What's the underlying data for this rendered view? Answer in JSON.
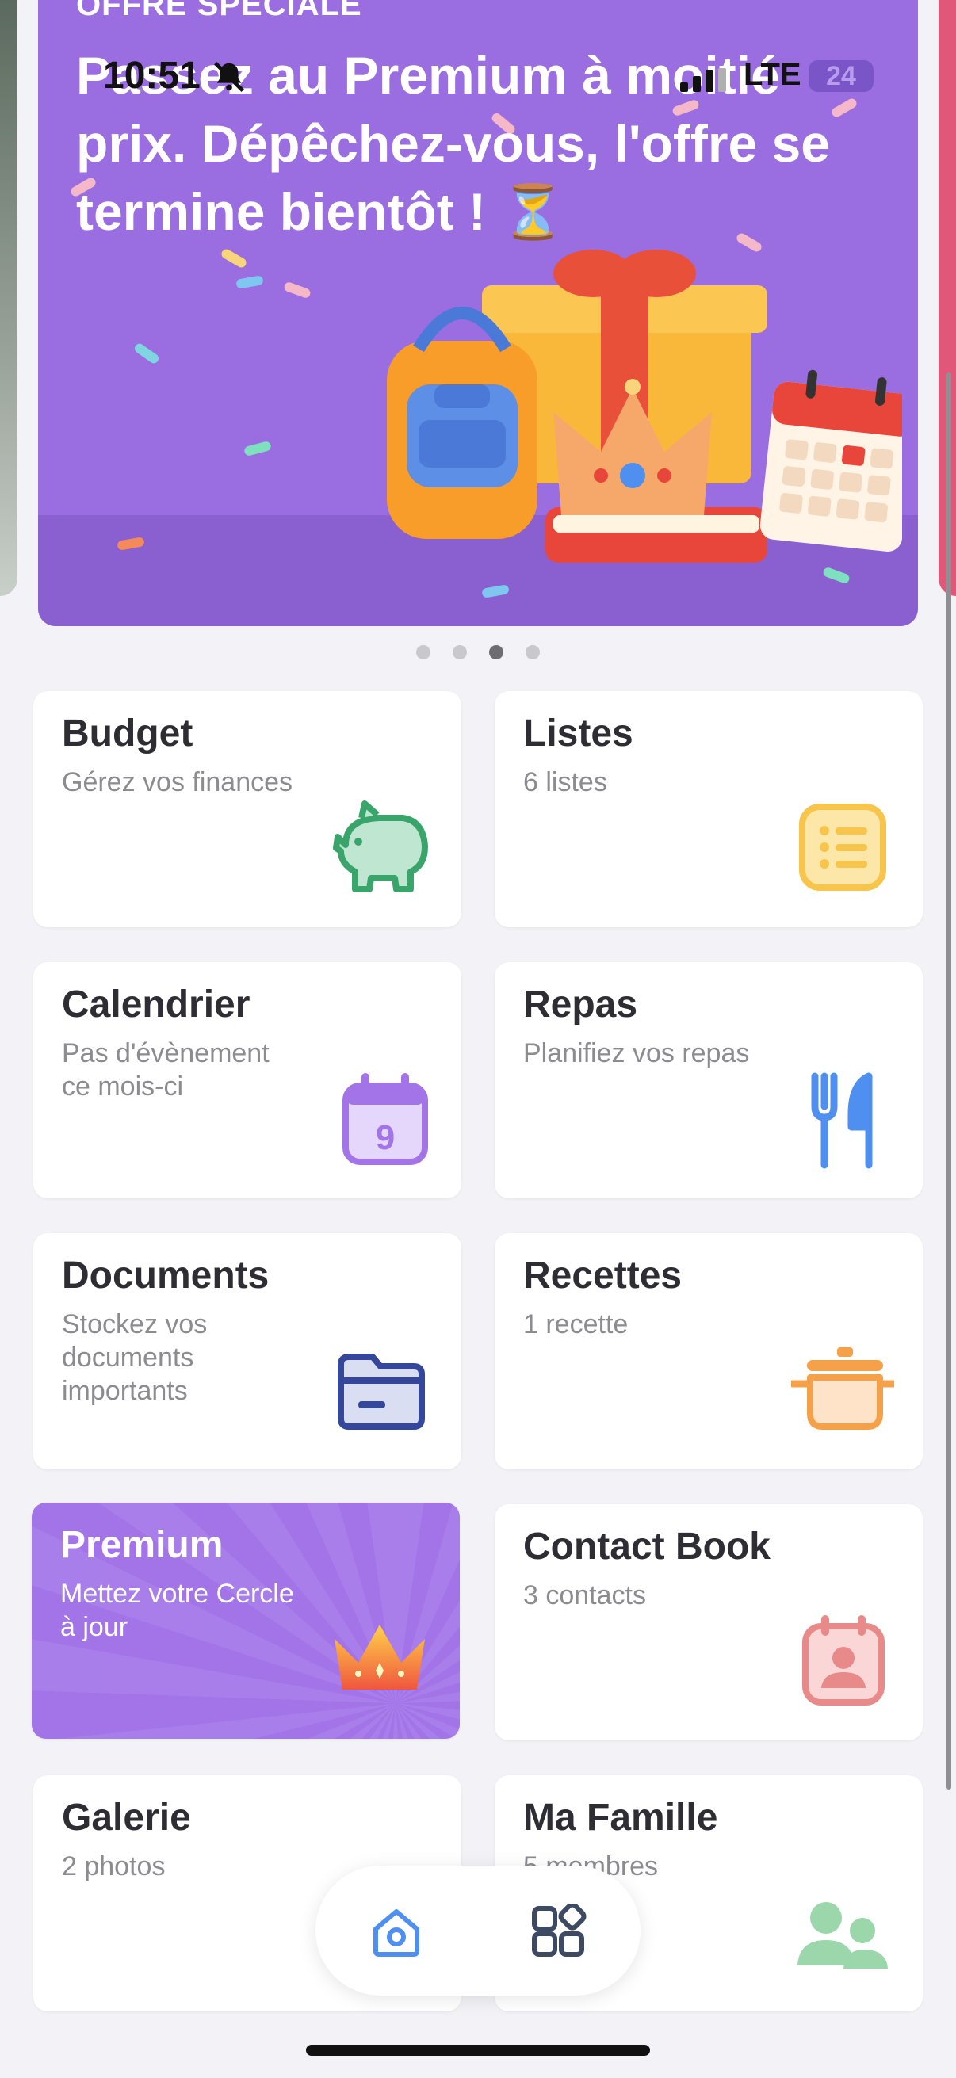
{
  "status_bar": {
    "time": "10:51",
    "network": "LTE",
    "battery": "24"
  },
  "banner": {
    "eyebrow": "OFFRE SPÉCIALE",
    "title": "Passez au Premium à moitié prix. Dépêchez-vous, l'offre se termine bientôt ! ⏳",
    "page_count": 4,
    "active_page": 3
  },
  "tiles": [
    {
      "title": "Budget",
      "subtitle": "Gérez vos finances",
      "icon": "piggy-bank-icon",
      "color": "#3aa56b"
    },
    {
      "title": "Listes",
      "subtitle": "6 listes",
      "icon": "list-icon",
      "color": "#f7c54b"
    },
    {
      "title": "Calendrier",
      "subtitle": "Pas d'évènement ce mois-ci",
      "icon": "calendar-icon",
      "color": "#a274e8",
      "day": "9"
    },
    {
      "title": "Repas",
      "subtitle": "Planifiez vos repas",
      "icon": "fork-knife-icon",
      "color": "#4f8ff0"
    },
    {
      "title": "Documents",
      "subtitle": "Stockez vos documents importants",
      "icon": "folder-icon",
      "color": "#34479a"
    },
    {
      "title": "Recettes",
      "subtitle": "1 recette",
      "icon": "cooking-pot-icon",
      "color": "#f5a14a"
    },
    {
      "title": "Premium",
      "subtitle": "Mettez votre Cercle à jour",
      "icon": "crown-icon",
      "color": "#a274e8"
    },
    {
      "title": "Contact Book",
      "subtitle": "3 contacts",
      "icon": "contact-card-icon",
      "color": "#e88a8a"
    },
    {
      "title": "Galerie",
      "subtitle": "2 photos",
      "icon": "gallery-icon",
      "color": "#8b8b90"
    },
    {
      "title": "Ma Famille",
      "subtitle": "5 membres",
      "icon": "family-icon",
      "color": "#9bd7ab"
    }
  ],
  "bottom_nav": {
    "home_icon": "home-icon",
    "apps_icon": "apps-grid-icon",
    "active_color": "#4f8ff0"
  }
}
